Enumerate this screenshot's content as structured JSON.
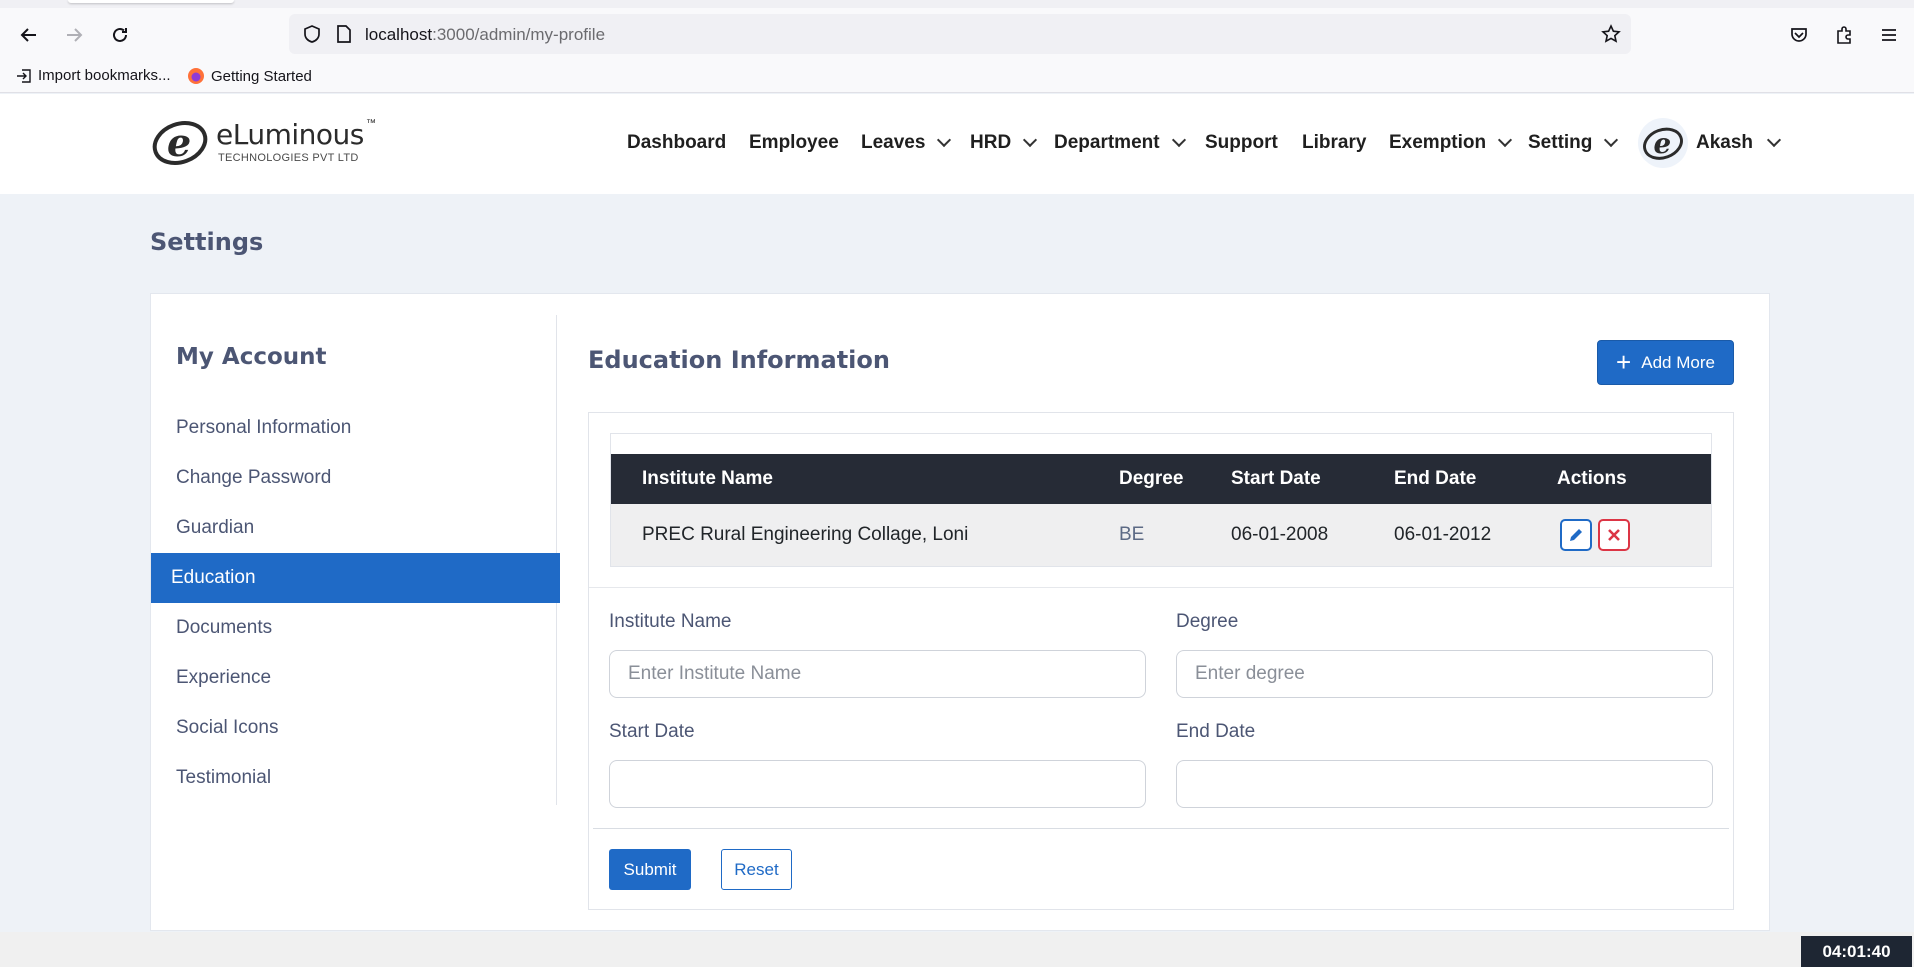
{
  "browser": {
    "url_host": "localhost",
    "url_path": ":3000/admin/my-profile",
    "bookmarks": [
      "Import bookmarks...",
      "Getting Started"
    ]
  },
  "header": {
    "brand": "eLuminous",
    "brand_tm": "™",
    "brand_tagline": "TECHNOLOGIES PVT LTD",
    "menu": [
      {
        "label": "Dashboard",
        "dropdown": false
      },
      {
        "label": "Employee",
        "dropdown": false
      },
      {
        "label": "Leaves",
        "dropdown": true
      },
      {
        "label": "HRD",
        "dropdown": true
      },
      {
        "label": "Department",
        "dropdown": true
      },
      {
        "label": "Support",
        "dropdown": false
      },
      {
        "label": "Library",
        "dropdown": false
      },
      {
        "label": "Exemption",
        "dropdown": true
      },
      {
        "label": "Setting",
        "dropdown": true
      }
    ],
    "user_name": "Akash"
  },
  "page": {
    "title": "Settings"
  },
  "sidebar": {
    "title": "My Account",
    "items": [
      {
        "label": "Personal Information",
        "active": false
      },
      {
        "label": "Change Password",
        "active": false
      },
      {
        "label": "Guardian",
        "active": false
      },
      {
        "label": "Education",
        "active": true
      },
      {
        "label": "Documents",
        "active": false
      },
      {
        "label": "Experience",
        "active": false
      },
      {
        "label": "Social Icons",
        "active": false
      },
      {
        "label": "Testimonial",
        "active": false
      }
    ]
  },
  "education": {
    "title": "Education Information",
    "add_more_label": "Add More",
    "table": {
      "columns": [
        "Institute Name",
        "Degree",
        "Start Date",
        "End Date",
        "Actions"
      ],
      "rows": [
        {
          "institute": "PREC Rural Engineering Collage, Loni",
          "degree": "BE",
          "start": "06-01-2008",
          "end": "06-01-2012"
        }
      ]
    },
    "form": {
      "institute_label": "Institute Name",
      "institute_placeholder": "Enter Institute Name",
      "degree_label": "Degree",
      "degree_placeholder": "Enter degree",
      "start_label": "Start Date",
      "start_value": "",
      "end_label": "End Date",
      "end_value": "",
      "submit_label": "Submit",
      "reset_label": "Reset"
    }
  },
  "clock": "04:01:40",
  "colors": {
    "primary": "#1f6ac6",
    "table_header": "#262b36",
    "text_muted": "#4c5674",
    "danger": "#dc3545"
  }
}
